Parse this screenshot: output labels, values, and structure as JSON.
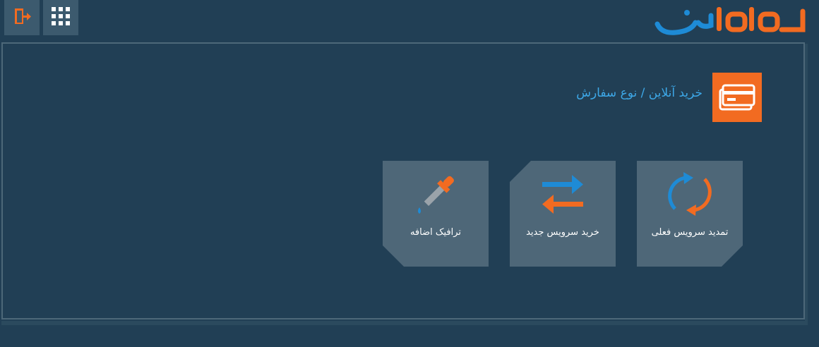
{
  "topbar": {
    "exit_icon": "exit-door-icon",
    "apps_icon": "apps-grid-icon"
  },
  "brand": {
    "logo_text": "ماهان نت",
    "colors": {
      "primary": "#f26b21",
      "secondary": "#1e8bd6"
    }
  },
  "page": {
    "title": "خرید آنلاین / نوع سفارش",
    "title_icon": "credit-card-icon",
    "title_color": "#3da8e8"
  },
  "tiles": [
    {
      "label": "تمدید سرویس فعلی",
      "icon": "renew-arrows-icon"
    },
    {
      "label": "خرید سرویس جدید",
      "icon": "swap-arrows-icon"
    },
    {
      "label": "ترافیک اضافه",
      "icon": "dropper-icon"
    }
  ],
  "colors": {
    "background": "#213f55",
    "tile": "#4e6778",
    "accent_orange": "#f26b21",
    "accent_blue": "#1e8bd6"
  }
}
